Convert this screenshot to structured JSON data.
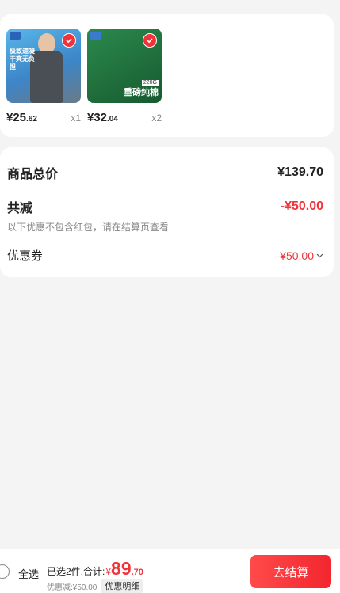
{
  "items": [
    {
      "thumb_text": "极致速凝 干爽无负担",
      "price_int": "¥25",
      "price_dec": ".62",
      "qty": "x1",
      "selected": true
    },
    {
      "thumb_badge": "220G",
      "thumb_text": "重磅纯棉",
      "price_int": "¥32",
      "price_dec": ".04",
      "qty": "x2",
      "selected": true
    }
  ],
  "summary": {
    "total_label": "商品总价",
    "total_value": "¥139.70",
    "reduce_label": "共减",
    "reduce_value": "-¥50.00",
    "note": "以下优惠不包含红包，请在结算页查看",
    "coupon_label": "优惠券",
    "coupon_value": "-¥50.00"
  },
  "footer": {
    "select_all": "全选",
    "selected_text": "已选2件,合计:",
    "currency": "¥",
    "total_int": "89",
    "total_dec": ".70",
    "discount_text": "优惠减:¥50.00",
    "detail_label": "优惠明细",
    "checkout_label": "去结算"
  },
  "colors": {
    "accent": "#f0343a",
    "background": "#f4f4f4"
  }
}
